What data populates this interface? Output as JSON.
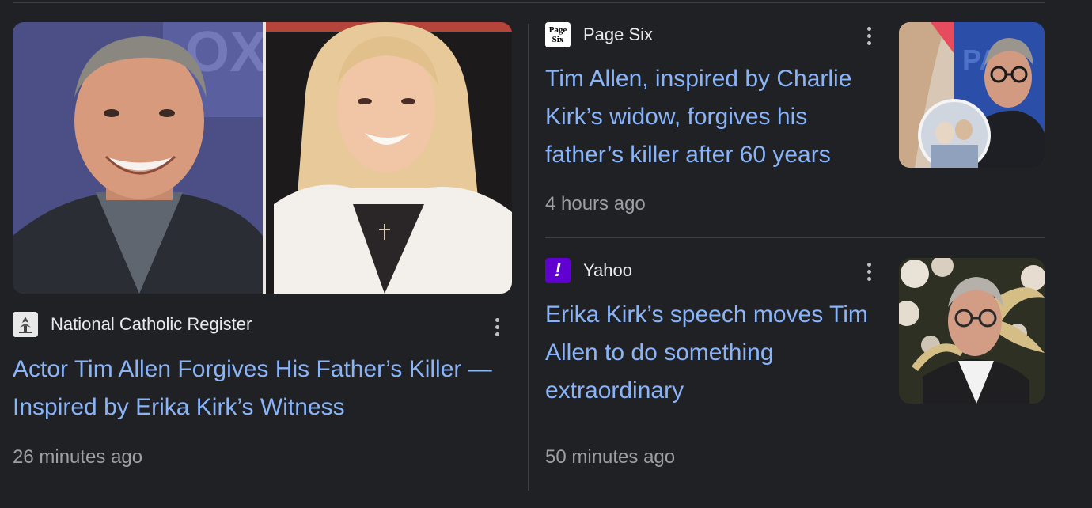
{
  "stories": [
    {
      "source": "National Catholic Register",
      "source_logo_icon": "ncr-logo-icon",
      "headline": "Actor Tim Allen Forgives His Father’s Killer — Inspired by Erika Kirk’s Witness",
      "time": "26 minutes ago"
    },
    {
      "source": "Page Six",
      "source_logo_text": "Page Six",
      "source_logo_icon": "page-six-logo-icon",
      "headline": "Tim Allen, inspired by Charlie Kirk’s widow, forgives his father’s killer after 60 years",
      "time": "4 hours ago"
    },
    {
      "source": "Yahoo",
      "source_logo_text": "!",
      "source_logo_icon": "yahoo-logo-icon",
      "headline": "Erika Kirk’s speech moves Tim Allen to do something extraordinary",
      "time": "50 minutes ago"
    }
  ],
  "colors": {
    "background": "#202124",
    "headline": "#8ab4f8",
    "source": "#e8eaed",
    "time": "#9aa0a6",
    "divider": "#3c4043",
    "yahoo_purple": "#6001d2"
  },
  "icons": {
    "more": "more-vert-icon"
  }
}
